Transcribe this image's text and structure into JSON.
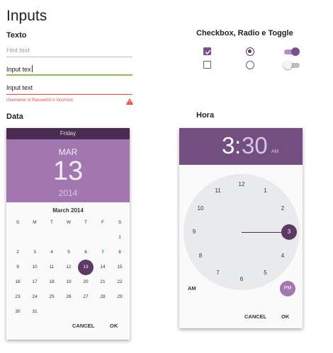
{
  "title": "Inputs",
  "texto": {
    "heading": "Texto",
    "hint_placeholder": "Hint text",
    "focused_value": "Input tex",
    "error_value": "Input text",
    "error_message": "Username or Password is incorrect."
  },
  "toggles": {
    "heading": "Checkbox, Radio e Toggle",
    "row_on": {
      "checkbox": true,
      "radio": true,
      "toggle": true
    },
    "row_off": {
      "checkbox": false,
      "radio": false,
      "toggle": false
    },
    "colors": {
      "accent": "#7b5090",
      "accent_dark": "#5a3766",
      "toggle_on_track": "#b68fc0",
      "toggle_off_track": "#bdbdbd",
      "toggle_off_knob": "#f5f5f5"
    }
  },
  "data": {
    "heading": "Data",
    "weekday": "Friday",
    "month": "MAR",
    "day": "13",
    "year": "2014",
    "calendar_title": "March 2014",
    "weekday_letters": [
      "S",
      "M",
      "T",
      "W",
      "T",
      "F",
      "S"
    ],
    "weeks": [
      [
        "",
        "",
        "",
        "",
        "",
        "",
        "1"
      ],
      [
        "2",
        "3",
        "4",
        "5",
        "6",
        "7",
        "8"
      ],
      [
        "9",
        "10",
        "11",
        "12",
        "13",
        "14",
        "15"
      ],
      [
        "16",
        "17",
        "18",
        "19",
        "20",
        "21",
        "22"
      ],
      [
        "23",
        "24",
        "25",
        "26",
        "27",
        "28",
        "29"
      ],
      [
        "30",
        "31",
        "",
        "",
        "",
        "",
        ""
      ]
    ],
    "selected_day": "13",
    "today_day": "7",
    "cancel_label": "CANCEL",
    "ok_label": "OK",
    "colors": {
      "header_dark": "#4a2b52",
      "header": "#a277b0",
      "selected": "#5e3967",
      "today": "#00a19b"
    }
  },
  "hora": {
    "heading": "Hora",
    "hour": "3",
    "separator": ":",
    "minute": "30",
    "period": "AM",
    "dial_numbers": [
      "12",
      "1",
      "2",
      "3",
      "4",
      "5",
      "6",
      "7",
      "8",
      "9",
      "10",
      "11"
    ],
    "selected_hour": "3",
    "am_label": "AM",
    "pm_label": "PM",
    "cancel_label": "CANCEL",
    "ok_label": "OK",
    "colors": {
      "header": "#724f80",
      "dial": "#e8eaec",
      "selected": "#5e3967",
      "pm_bubble": "#a277b0"
    }
  }
}
